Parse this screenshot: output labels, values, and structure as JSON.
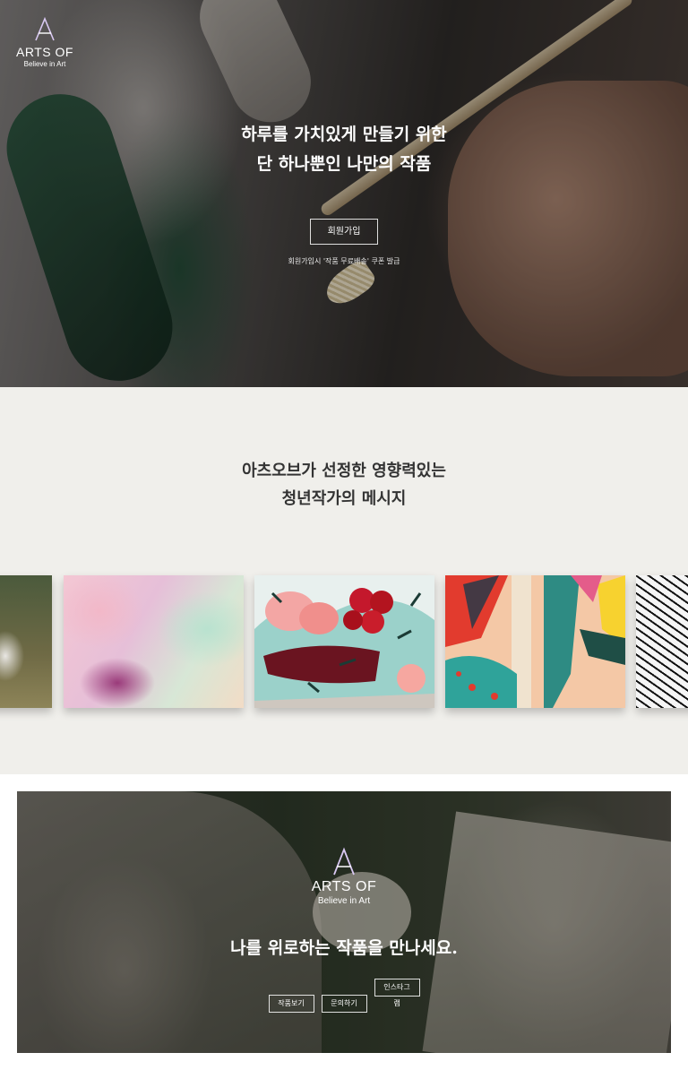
{
  "brand": {
    "name": "ARTS OF",
    "tagline": "Believe in Art"
  },
  "hero": {
    "title_line1": "하루를 가치있게 만들기 위한",
    "title_line2": "단 하나뿐인 나만의 작품",
    "signup_label": "회원가입",
    "note": "회원가입시 '작품 무료배송' 쿠폰 발급"
  },
  "message": {
    "title_line1": "아츠오브가 선정한 영향력있는",
    "title_line2": "청년작가의 메시지",
    "artworks": [
      {
        "name": "artwork-girl-field"
      },
      {
        "name": "artwork-pink-abstract"
      },
      {
        "name": "artwork-peaches-cherries"
      },
      {
        "name": "artwork-colorful-shapes"
      },
      {
        "name": "artwork-line-drawing"
      }
    ]
  },
  "banner": {
    "title": "나를 위로하는 작품을 만나세요.",
    "buttons": {
      "works": "작품보기",
      "contact": "문의하기",
      "instagram": "인스타그램"
    }
  },
  "colors": {
    "section_bg": "#f0efeb",
    "logo_accent": "#c8b8e6"
  }
}
